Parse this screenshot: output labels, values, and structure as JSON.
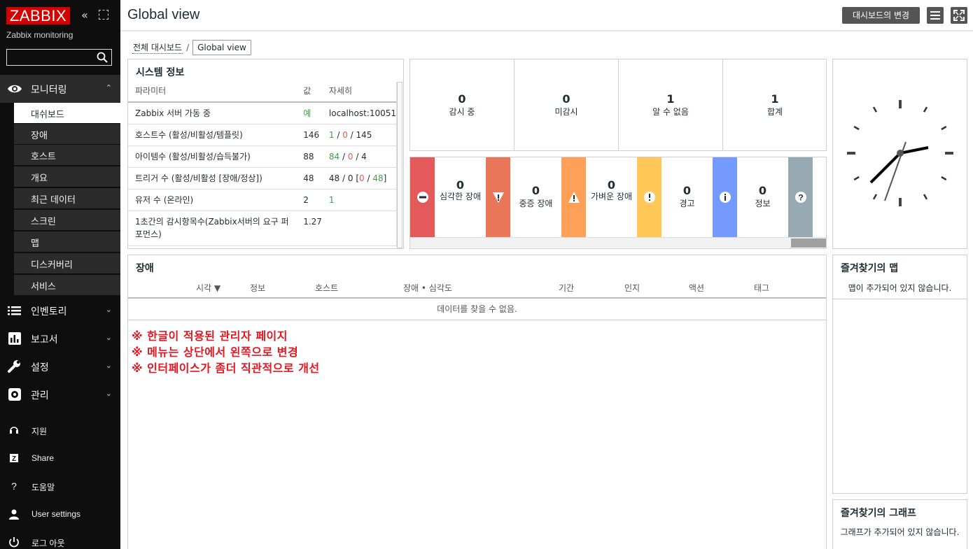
{
  "sidebar": {
    "logo": "ZABBIX",
    "server_name": "Zabbix monitoring",
    "search": {
      "value": "",
      "placeholder": ""
    },
    "monitoring": {
      "label": "모니터링",
      "items": [
        "대쉬보드",
        "장애",
        "호스트",
        "개요",
        "최근 데이터",
        "스크린",
        "맵",
        "디스커버리",
        "서비스"
      ]
    },
    "sections": [
      {
        "label": "인벤토리",
        "icon": "list-icon"
      },
      {
        "label": "보고서",
        "icon": "bar-chart-icon"
      },
      {
        "label": "설정",
        "icon": "wrench-icon"
      },
      {
        "label": "관리",
        "icon": "gear-icon"
      }
    ],
    "bottom": [
      {
        "label": "지원",
        "icon": "headset-icon"
      },
      {
        "label": "Share",
        "icon": "share-z-icon"
      },
      {
        "label": "도움말",
        "icon": "question-icon"
      },
      {
        "label": "User settings",
        "icon": "user-icon"
      },
      {
        "label": "로그 아웃",
        "icon": "power-icon"
      }
    ]
  },
  "header": {
    "title": "Global view",
    "edit_button": "대시보드의 변경"
  },
  "breadcrumb": {
    "parent": "전체 대시보드",
    "separator": "/",
    "current": "Global view"
  },
  "system_info": {
    "title": "시스템 정보",
    "columns": [
      "파라미터",
      "값",
      "자세히"
    ],
    "rows": [
      {
        "param": "Zabbix 서버 가동 중",
        "value": "예",
        "detail": "localhost:10051"
      },
      {
        "param": "호스트수 (활성/비활성/템플릿)",
        "value": "146",
        "detail_a": "1",
        "detail_b": "0",
        "detail_c": "145"
      },
      {
        "param": "아이템수 (활성/비활성/습득불가)",
        "value": "88",
        "detail_a": "84",
        "detail_b": "0",
        "detail_c": "4"
      },
      {
        "param": "트리거 수 (활성/비활성 [장애/정상])",
        "value": "48",
        "detail_a": "48",
        "detail_b": "0",
        "detail_c": "0",
        "detail_d": "48"
      },
      {
        "param": "유저 수 (온라인)",
        "value": "2",
        "detail": "1"
      },
      {
        "param": "1초간의 감시항목수(Zabbix서버의 요구 퍼포먼스)",
        "value": "1.27",
        "detail": ""
      }
    ]
  },
  "host_availability": [
    {
      "count": "0",
      "label": "감시 중"
    },
    {
      "count": "0",
      "label": "미감시"
    },
    {
      "count": "1",
      "label": "알 수 없음"
    },
    {
      "count": "1",
      "label": "합계"
    }
  ],
  "severity": [
    {
      "count": "0",
      "label": "심각한 장애",
      "color": "#e45959"
    },
    {
      "count": "0",
      "label": "중증 장애",
      "color": "#e97659"
    },
    {
      "count": "0",
      "label": "가벼운 장애",
      "color": "#ffa059"
    },
    {
      "count": "0",
      "label": "경고",
      "color": "#ffc859"
    },
    {
      "count": "0",
      "label": "정보",
      "color": "#7499ff"
    },
    {
      "count": "",
      "label": "",
      "color": "#97aab3"
    }
  ],
  "problems": {
    "title": "장애",
    "columns": [
      "시각 ▼",
      "정보",
      "호스트",
      "장애 • 심각도",
      "기간",
      "인지",
      "액션",
      "태그"
    ],
    "no_data": "데이터를 찾을 수 없음.",
    "annotations": [
      "※ 한글이 적용된 관리자 페이지",
      "※ 메뉴는 상단에서 왼쪽으로 변경",
      "※ 인터페이스가 좀더 직관적으로 개선"
    ]
  },
  "favorite_maps": {
    "title": "즐겨찾기의 맵",
    "message": "맵이 추가되어 있지 않습니다."
  },
  "favorite_graphs": {
    "title": "즐겨찾기의 그래프",
    "message": "그래프가 추가되어 있지 않습니다."
  }
}
